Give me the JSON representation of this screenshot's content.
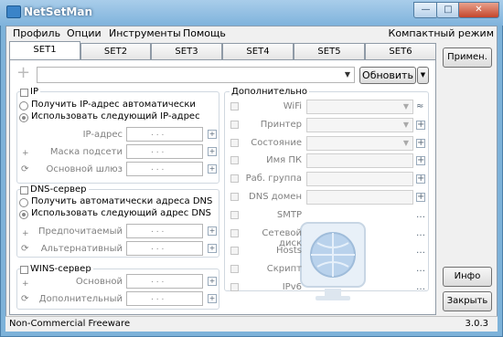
{
  "app": {
    "title": "NetSetMan"
  },
  "menu": {
    "items": [
      "Профиль",
      "Опции",
      "Инструменты",
      "Помощь"
    ],
    "compact": "Компактный режим"
  },
  "tabs": [
    "SET1",
    "SET2",
    "SET3",
    "SET4",
    "SET5",
    "SET6"
  ],
  "toolbar": {
    "refresh": "Обновить"
  },
  "ip": {
    "title": "IP",
    "auto": "Получить IP-адрес автоматически",
    "manual": "Использовать следующий IP-адрес",
    "address_label": "IP-адрес",
    "mask_label": "Маска подсети",
    "gateway_label": "Основной шлюз"
  },
  "dns": {
    "title": "DNS-сервер",
    "auto": "Получить автоматически адреса DNS",
    "manual": "Использовать следующий адрес DNS",
    "preferred_label": "Предпочитаемый",
    "alternate_label": "Альтернативный"
  },
  "wins": {
    "title": "WINS-сервер",
    "primary_label": "Основной",
    "secondary_label": "Дополнительный"
  },
  "extra": {
    "title": "Дополнительно",
    "rows": [
      "WiFi",
      "Принтер",
      "Состояние",
      "Имя ПК",
      "Раб. группа",
      "DNS домен",
      "SMTP",
      "Сетевой диск",
      "Hosts",
      "Скрипт",
      "IPv6"
    ]
  },
  "right": {
    "apply": "Примен.",
    "info": "Инфо",
    "close": "Закрыть"
  },
  "status": {
    "left": "Non-Commercial Freeware",
    "version": "3.0.3"
  },
  "ip_placeholder": ". . .",
  "colors": {
    "titlebar": "#7fb3dc",
    "accent": "#3b84c8"
  }
}
